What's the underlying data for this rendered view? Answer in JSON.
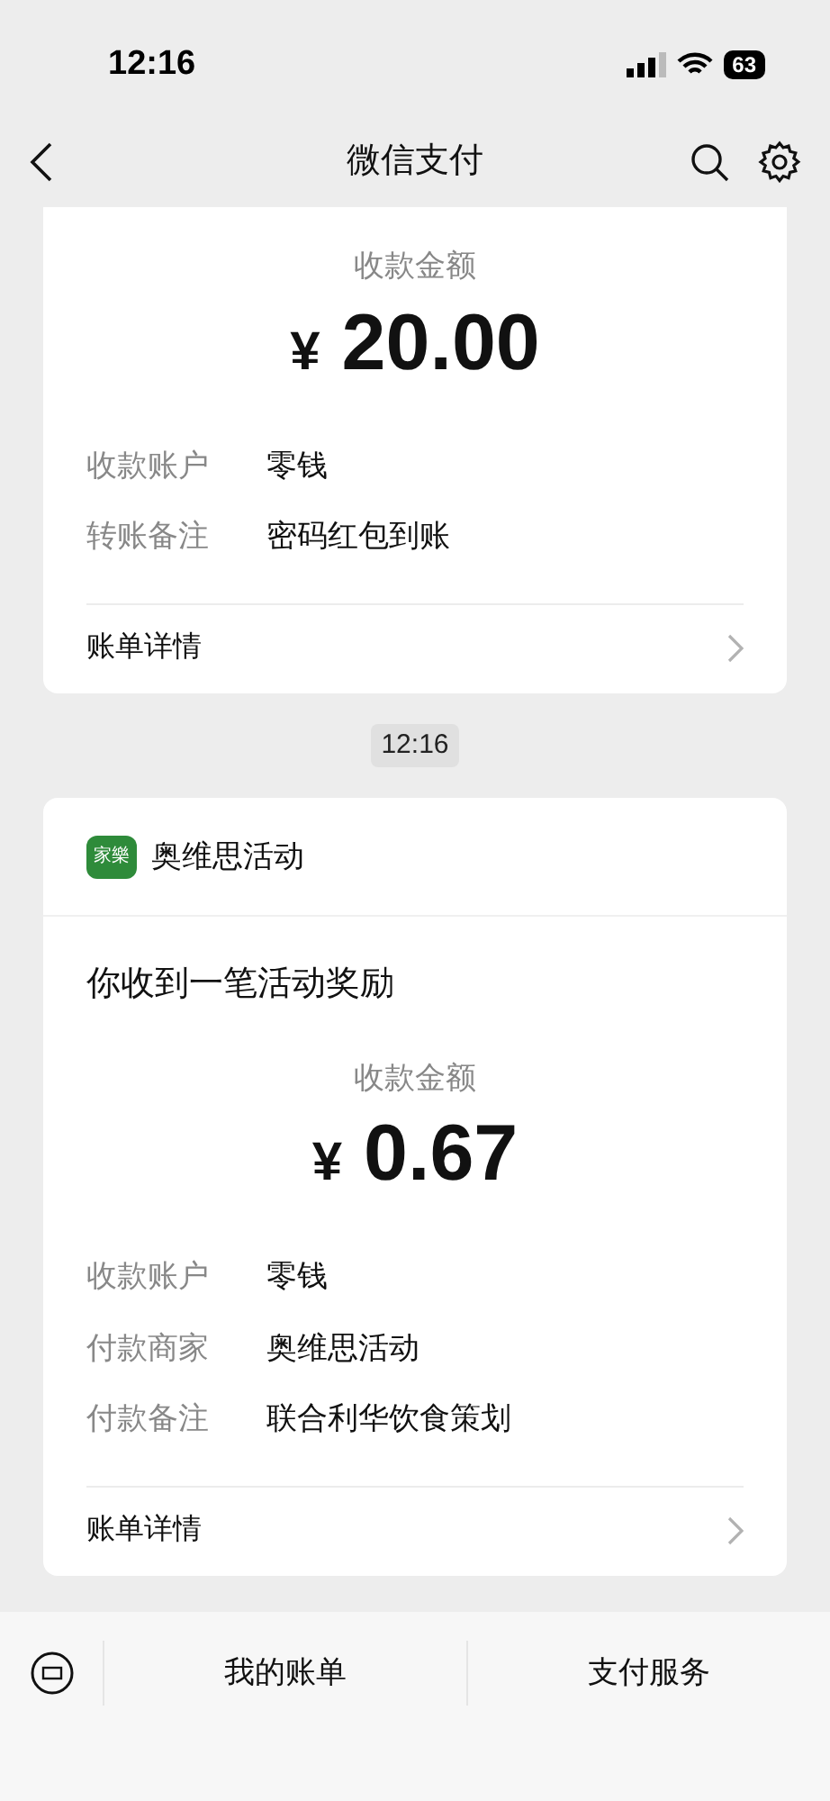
{
  "status_bar": {
    "time": "12:16",
    "battery": "63"
  },
  "nav": {
    "title": "微信支付"
  },
  "messages": [
    {
      "kind": "transfer",
      "amount_label": "收款金额",
      "currency": "¥",
      "amount": "20.00",
      "fields": [
        {
          "label": "收款账户",
          "value": "零钱"
        },
        {
          "label": "转账备注",
          "value": "密码红包到账"
        }
      ],
      "footer": "账单详情"
    },
    {
      "kind": "timestamp",
      "text": "12:16"
    },
    {
      "kind": "reward",
      "sender": {
        "logo": "家樂",
        "name": "奥维思活动"
      },
      "headline": "你收到一笔活动奖励",
      "amount_label": "收款金额",
      "currency": "¥",
      "amount": "0.67",
      "fields": [
        {
          "label": "收款账户",
          "value": "零钱"
        },
        {
          "label": "付款商家",
          "value": "奥维思活动"
        },
        {
          "label": "付款备注",
          "value": "联合利华饮食策划"
        }
      ],
      "footer": "账单详情"
    }
  ],
  "bottom_bar": {
    "tabs": [
      "我的账单",
      "支付服务"
    ]
  }
}
